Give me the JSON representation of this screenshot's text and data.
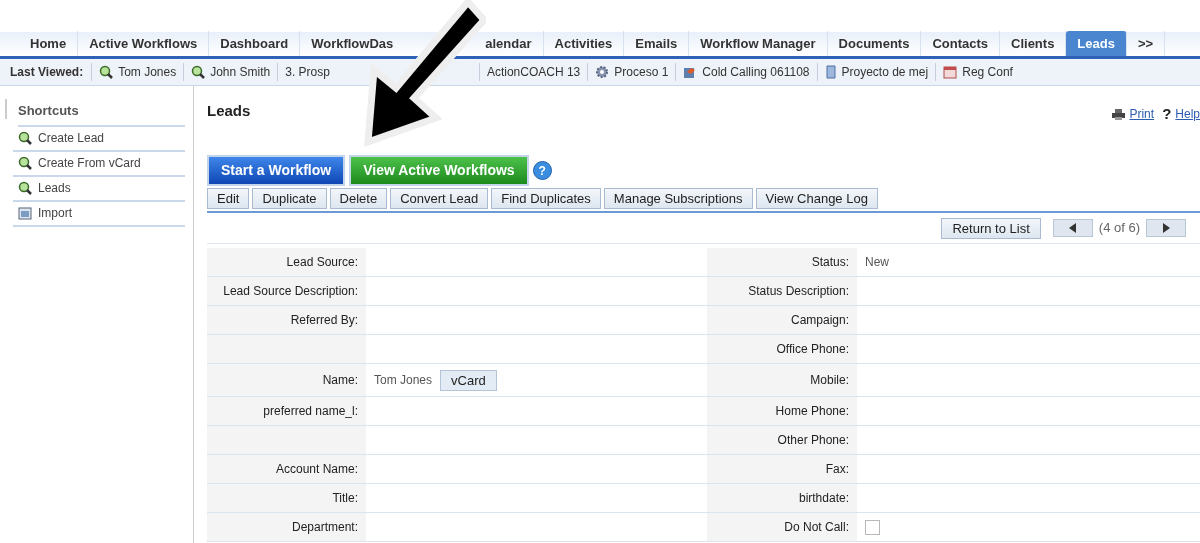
{
  "tabs": [
    {
      "label": "Home",
      "selected": false
    },
    {
      "label": "Active Workflows",
      "selected": false
    },
    {
      "label": "Dashboard",
      "selected": false
    },
    {
      "label": "WorkflowDas",
      "selected": false,
      "kind": "cut-end"
    },
    {
      "label": "alendar",
      "selected": false,
      "kind": "cut-start"
    },
    {
      "label": "Activities",
      "selected": false
    },
    {
      "label": "Emails",
      "selected": false
    },
    {
      "label": "Workflow Manager",
      "selected": false
    },
    {
      "label": "Documents",
      "selected": false
    },
    {
      "label": "Contacts",
      "selected": false
    },
    {
      "label": "Clients",
      "selected": false
    },
    {
      "label": "Leads",
      "selected": true
    },
    {
      "label": ">>",
      "selected": false
    }
  ],
  "last_viewed": {
    "label": "Last Viewed:",
    "items": [
      {
        "label": "Tom Jones",
        "kind": "lead"
      },
      {
        "label": "John Smith",
        "kind": "lead"
      },
      {
        "label": "3. Prosp",
        "kind": "cut-end"
      },
      {
        "label": "ActionCOACH 13",
        "kind": "none"
      },
      {
        "label": "Proceso 1",
        "kind": "gear"
      },
      {
        "label": "Cold Calling 061108",
        "kind": "campaign"
      },
      {
        "label": "Proyecto de mej",
        "kind": "project"
      },
      {
        "label": "Reg Conf",
        "kind": "calendar"
      }
    ]
  },
  "sidebar": {
    "title": "Shortcuts",
    "items": [
      {
        "label": "Create Lead",
        "kind": "lead"
      },
      {
        "label": "Create From vCard",
        "kind": "lead"
      },
      {
        "label": "Leads",
        "kind": "search"
      },
      {
        "label": "Import",
        "kind": "import"
      }
    ]
  },
  "page": {
    "title": "Leads",
    "links": [
      {
        "label": "Print",
        "kind": "print"
      },
      {
        "label": "Help",
        "kind": "help",
        "icon": "?"
      }
    ],
    "help_icon": "?",
    "workflow_buttons": [
      {
        "label": "Start a Workflow",
        "kind": "blue"
      },
      {
        "label": "View Active Workflows",
        "kind": "green"
      }
    ],
    "actions": [
      "Edit",
      "Duplicate",
      "Delete",
      "Convert Lead",
      "Find Duplicates",
      "Manage Subscriptions",
      "View Change Log"
    ],
    "return_button": "Return to List",
    "pager": "(4 of 6)"
  },
  "fields": [
    {
      "left": {
        "label": "Lead Source:"
      },
      "right": {
        "label": "Status:",
        "value": "New"
      }
    },
    {
      "left": {
        "label": "Lead Source Description:"
      },
      "right": {
        "label": "Status Description:"
      }
    },
    {
      "left": {
        "label": "Referred By:"
      },
      "right": {
        "label": "Campaign:"
      }
    },
    {
      "right": {
        "label": "Office Phone:"
      }
    },
    {
      "left": {
        "label": "Name:",
        "value": "Tom Jones",
        "button": "vCard"
      },
      "right": {
        "label": "Mobile:"
      }
    },
    {
      "left": {
        "label": "preferred name_l:"
      },
      "right": {
        "label": "Home Phone:"
      }
    },
    {
      "right": {
        "label": "Other Phone:"
      }
    },
    {
      "left": {
        "label": "Account Name:"
      },
      "right": {
        "label": "Fax:"
      }
    },
    {
      "left": {
        "label": "Title:"
      },
      "right": {
        "label": "birthdate:"
      }
    },
    {
      "left": {
        "label": "Department:"
      },
      "right": {
        "label": "Do Not Call:",
        "checked": false
      }
    }
  ]
}
